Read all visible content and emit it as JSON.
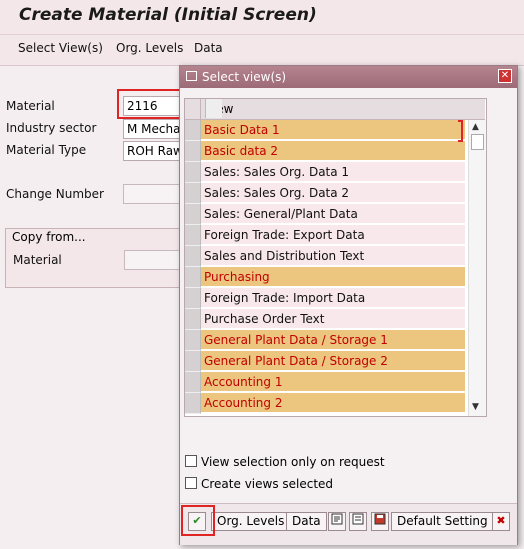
{
  "window": {
    "title": "Create Material (Initial Screen)"
  },
  "menu": {
    "items": [
      "Select View(s)",
      "Org. Levels",
      "Data"
    ]
  },
  "form": {
    "material_label": "Material",
    "material_value": "2116",
    "industry_label": "Industry sector",
    "industry_value": "M Mechan",
    "type_label": "Material Type",
    "type_value": "ROH Raw",
    "change_label": "Change Number",
    "copy_from_title": "Copy from...",
    "copy_material_label": "Material"
  },
  "dialog": {
    "title": "Select view(s)",
    "close_glyph": "✕",
    "column_header": "View",
    "views": [
      {
        "label": "Basic Data 1",
        "selected": true
      },
      {
        "label": "Basic data 2",
        "selected": true
      },
      {
        "label": "Sales: Sales Org. Data 1",
        "selected": false
      },
      {
        "label": "Sales: Sales Org. Data 2",
        "selected": false
      },
      {
        "label": "Sales: General/Plant Data",
        "selected": false
      },
      {
        "label": "Foreign Trade: Export Data",
        "selected": false
      },
      {
        "label": "Sales and Distribution Text",
        "selected": false
      },
      {
        "label": "Purchasing",
        "selected": true
      },
      {
        "label": "Foreign Trade: Import Data",
        "selected": false
      },
      {
        "label": "Purchase Order Text",
        "selected": false
      },
      {
        "label": "General Plant Data / Storage 1",
        "selected": true
      },
      {
        "label": "General Plant Data / Storage 2",
        "selected": true
      },
      {
        "label": "Accounting 1",
        "selected": true
      },
      {
        "label": "Accounting 2",
        "selected": true
      }
    ],
    "options": {
      "view_on_request": "View selection only on request",
      "create_selected": "Create views selected"
    },
    "buttons": {
      "ok_glyph": "✔",
      "org_levels": "Org. Levels",
      "data": "Data",
      "default_setting": "Default Setting",
      "cancel_glyph": "✖"
    }
  },
  "colors": {
    "selected_row": "#ecc57f",
    "selected_text": "#c00000",
    "highlight": "#e02424"
  }
}
